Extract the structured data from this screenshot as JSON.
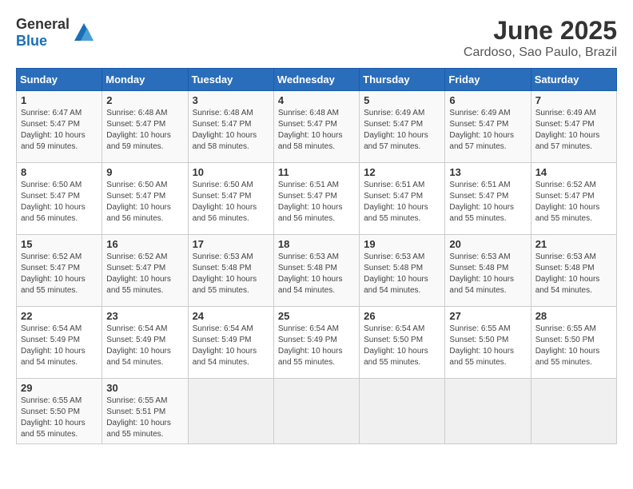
{
  "header": {
    "logo_general": "General",
    "logo_blue": "Blue",
    "title": "June 2025",
    "subtitle": "Cardoso, Sao Paulo, Brazil"
  },
  "columns": [
    "Sunday",
    "Monday",
    "Tuesday",
    "Wednesday",
    "Thursday",
    "Friday",
    "Saturday"
  ],
  "weeks": [
    [
      {
        "day": "1",
        "sunrise": "6:47 AM",
        "sunset": "5:47 PM",
        "daylight": "10 hours and 59 minutes."
      },
      {
        "day": "2",
        "sunrise": "6:48 AM",
        "sunset": "5:47 PM",
        "daylight": "10 hours and 59 minutes."
      },
      {
        "day": "3",
        "sunrise": "6:48 AM",
        "sunset": "5:47 PM",
        "daylight": "10 hours and 58 minutes."
      },
      {
        "day": "4",
        "sunrise": "6:48 AM",
        "sunset": "5:47 PM",
        "daylight": "10 hours and 58 minutes."
      },
      {
        "day": "5",
        "sunrise": "6:49 AM",
        "sunset": "5:47 PM",
        "daylight": "10 hours and 57 minutes."
      },
      {
        "day": "6",
        "sunrise": "6:49 AM",
        "sunset": "5:47 PM",
        "daylight": "10 hours and 57 minutes."
      },
      {
        "day": "7",
        "sunrise": "6:49 AM",
        "sunset": "5:47 PM",
        "daylight": "10 hours and 57 minutes."
      }
    ],
    [
      {
        "day": "8",
        "sunrise": "6:50 AM",
        "sunset": "5:47 PM",
        "daylight": "10 hours and 56 minutes."
      },
      {
        "day": "9",
        "sunrise": "6:50 AM",
        "sunset": "5:47 PM",
        "daylight": "10 hours and 56 minutes."
      },
      {
        "day": "10",
        "sunrise": "6:50 AM",
        "sunset": "5:47 PM",
        "daylight": "10 hours and 56 minutes."
      },
      {
        "day": "11",
        "sunrise": "6:51 AM",
        "sunset": "5:47 PM",
        "daylight": "10 hours and 56 minutes."
      },
      {
        "day": "12",
        "sunrise": "6:51 AM",
        "sunset": "5:47 PM",
        "daylight": "10 hours and 55 minutes."
      },
      {
        "day": "13",
        "sunrise": "6:51 AM",
        "sunset": "5:47 PM",
        "daylight": "10 hours and 55 minutes."
      },
      {
        "day": "14",
        "sunrise": "6:52 AM",
        "sunset": "5:47 PM",
        "daylight": "10 hours and 55 minutes."
      }
    ],
    [
      {
        "day": "15",
        "sunrise": "6:52 AM",
        "sunset": "5:47 PM",
        "daylight": "10 hours and 55 minutes."
      },
      {
        "day": "16",
        "sunrise": "6:52 AM",
        "sunset": "5:47 PM",
        "daylight": "10 hours and 55 minutes."
      },
      {
        "day": "17",
        "sunrise": "6:53 AM",
        "sunset": "5:48 PM",
        "daylight": "10 hours and 55 minutes."
      },
      {
        "day": "18",
        "sunrise": "6:53 AM",
        "sunset": "5:48 PM",
        "daylight": "10 hours and 54 minutes."
      },
      {
        "day": "19",
        "sunrise": "6:53 AM",
        "sunset": "5:48 PM",
        "daylight": "10 hours and 54 minutes."
      },
      {
        "day": "20",
        "sunrise": "6:53 AM",
        "sunset": "5:48 PM",
        "daylight": "10 hours and 54 minutes."
      },
      {
        "day": "21",
        "sunrise": "6:53 AM",
        "sunset": "5:48 PM",
        "daylight": "10 hours and 54 minutes."
      }
    ],
    [
      {
        "day": "22",
        "sunrise": "6:54 AM",
        "sunset": "5:49 PM",
        "daylight": "10 hours and 54 minutes."
      },
      {
        "day": "23",
        "sunrise": "6:54 AM",
        "sunset": "5:49 PM",
        "daylight": "10 hours and 54 minutes."
      },
      {
        "day": "24",
        "sunrise": "6:54 AM",
        "sunset": "5:49 PM",
        "daylight": "10 hours and 54 minutes."
      },
      {
        "day": "25",
        "sunrise": "6:54 AM",
        "sunset": "5:49 PM",
        "daylight": "10 hours and 55 minutes."
      },
      {
        "day": "26",
        "sunrise": "6:54 AM",
        "sunset": "5:50 PM",
        "daylight": "10 hours and 55 minutes."
      },
      {
        "day": "27",
        "sunrise": "6:55 AM",
        "sunset": "5:50 PM",
        "daylight": "10 hours and 55 minutes."
      },
      {
        "day": "28",
        "sunrise": "6:55 AM",
        "sunset": "5:50 PM",
        "daylight": "10 hours and 55 minutes."
      }
    ],
    [
      {
        "day": "29",
        "sunrise": "6:55 AM",
        "sunset": "5:50 PM",
        "daylight": "10 hours and 55 minutes."
      },
      {
        "day": "30",
        "sunrise": "6:55 AM",
        "sunset": "5:51 PM",
        "daylight": "10 hours and 55 minutes."
      },
      null,
      null,
      null,
      null,
      null
    ]
  ]
}
